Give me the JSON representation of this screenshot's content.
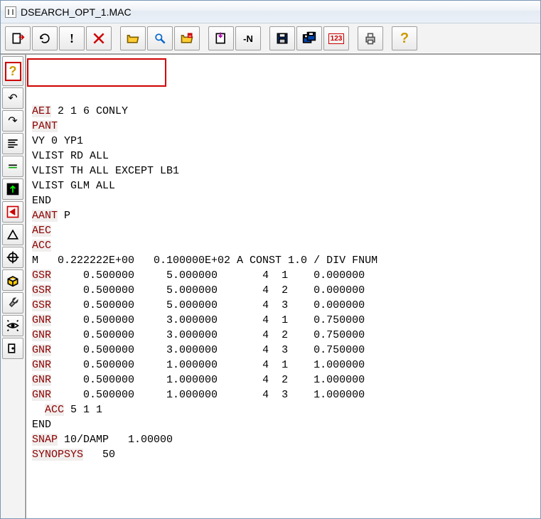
{
  "title": "DSEARCH_OPT_1.MAC",
  "toolbar_main": [
    {
      "name": "export-icon",
      "svg": "export"
    },
    {
      "name": "refresh-icon",
      "svg": "refresh"
    },
    {
      "name": "exclaim-icon",
      "svg": "exclaim"
    },
    {
      "name": "delete-icon",
      "svg": "delete"
    },
    {
      "gap": true
    },
    {
      "name": "open-icon",
      "svg": "open"
    },
    {
      "name": "search-icon",
      "svg": "search"
    },
    {
      "name": "mail-icon",
      "svg": "mail"
    },
    {
      "gap": true
    },
    {
      "name": "import-icon",
      "svg": "import"
    },
    {
      "name": "dash-n-icon",
      "svg": "-N",
      "text": true
    },
    {
      "gap": true
    },
    {
      "name": "save-icon",
      "svg": "save"
    },
    {
      "name": "saveas-icon",
      "svg": "saveas"
    },
    {
      "name": "number-icon",
      "svg": "123",
      "text": true
    },
    {
      "gap": true
    },
    {
      "name": "print-icon",
      "svg": "print"
    },
    {
      "gap": true
    },
    {
      "name": "help-icon",
      "svg": "help"
    }
  ],
  "toolbar_side": [
    {
      "name": "context-help-icon",
      "svg": "help-red",
      "tall": true
    },
    {
      "name": "undo-icon",
      "svg": "undo"
    },
    {
      "name": "redo-icon",
      "svg": "redo"
    },
    {
      "name": "align-icon",
      "svg": "align"
    },
    {
      "name": "equals-icon",
      "svg": "equals"
    },
    {
      "name": "up-arrow-icon",
      "svg": "up"
    },
    {
      "name": "back-icon",
      "svg": "back"
    },
    {
      "name": "delta-icon",
      "svg": "delta"
    },
    {
      "name": "target-icon",
      "svg": "target"
    },
    {
      "name": "box-icon",
      "svg": "box"
    },
    {
      "name": "wrench-icon",
      "svg": "wrench"
    },
    {
      "name": "eye-icon",
      "svg": "eye"
    },
    {
      "name": "exit-icon",
      "svg": "exit"
    }
  ],
  "code": {
    "lines": [
      {
        "kw": "AEI",
        "rest": " 2 1 6 CONLY"
      },
      {
        "kw": "PANT",
        "rest": ""
      },
      {
        "kw": "",
        "rest": "VY 0 YP1"
      },
      {
        "kw": "",
        "rest": "VLIST RD ALL"
      },
      {
        "kw": "",
        "rest": "VLIST TH ALL EXCEPT LB1"
      },
      {
        "kw": "",
        "rest": "VLIST GLM ALL"
      },
      {
        "kw": "",
        "rest": "END"
      },
      {
        "kw": "AANT",
        "rest": " P"
      },
      {
        "kw": "AEC",
        "rest": ""
      },
      {
        "kw": "ACC",
        "rest": ""
      },
      {
        "kw": "",
        "rest": "M   0.222222E+00   0.100000E+02 A CONST 1.0 / DIV FNUM"
      },
      {
        "kw": "GSR",
        "rest": "     0.500000     5.000000       4  1    0.000000"
      },
      {
        "kw": "GSR",
        "rest": "     0.500000     5.000000       4  2    0.000000"
      },
      {
        "kw": "GSR",
        "rest": "     0.500000     5.000000       4  3    0.000000"
      },
      {
        "kw": "GNR",
        "rest": "     0.500000     3.000000       4  1    0.750000"
      },
      {
        "kw": "GNR",
        "rest": "     0.500000     3.000000       4  2    0.750000"
      },
      {
        "kw": "GNR",
        "rest": "     0.500000     3.000000       4  3    0.750000"
      },
      {
        "kw": "GNR",
        "rest": "     0.500000     1.000000       4  1    1.000000"
      },
      {
        "kw": "GNR",
        "rest": "     0.500000     1.000000       4  2    1.000000"
      },
      {
        "kw": "GNR",
        "rest": "     0.500000     1.000000       4  3    1.000000"
      },
      {
        "pre": "  ",
        "kw": "ACC",
        "rest": " 5 1 1"
      },
      {
        "kw": "",
        "rest": "END"
      },
      {
        "kw": "SNAP",
        "rest": " 10/DAMP   1.00000"
      },
      {
        "kw": "SYNOPSYS",
        "rest": "   50"
      }
    ]
  }
}
